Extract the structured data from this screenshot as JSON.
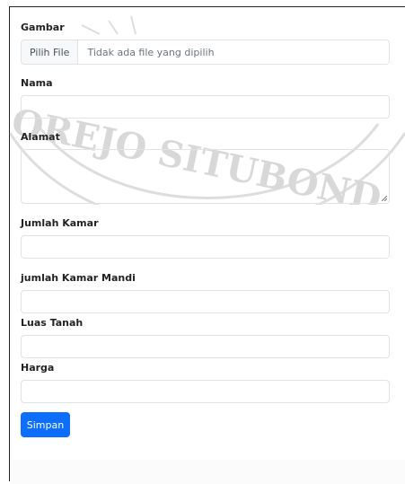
{
  "watermark": {
    "text": "OREJO SITUBOND"
  },
  "form": {
    "gambar_label": "Gambar",
    "file_button_label": "Pilih File",
    "file_status": "Tidak ada file yang dipilih",
    "nama_label": "Nama",
    "nama_value": "",
    "alamat_label": "Alamat",
    "alamat_value": "",
    "jumlah_kamar_label": "Jumlah Kamar",
    "jumlah_kamar_value": "",
    "jumlah_kamar_mandi_label": "jumlah Kamar Mandi",
    "jumlah_kamar_mandi_value": "",
    "luas_tanah_label": "Luas Tanah",
    "luas_tanah_value": "",
    "harga_label": "Harga",
    "harga_value": "",
    "submit_label": "Simpan"
  },
  "colors": {
    "primary": "#0d6efd",
    "border": "#dfe3e8",
    "label": "#222222"
  }
}
